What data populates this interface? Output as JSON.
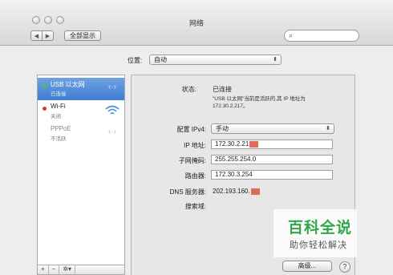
{
  "window": {
    "title": "网络"
  },
  "toolbar": {
    "back_icon": "chevron-left-icon",
    "forward_icon": "chevron-right-icon",
    "show_all": "全部显示",
    "search_placeholder": "",
    "search_icon": "magnifier-icon"
  },
  "location": {
    "label": "位置:",
    "value": "自动"
  },
  "services": [
    {
      "name": "USB 以太网",
      "status": "已连接",
      "dot_color": "#4cc24c",
      "icon": "ethernet-arrows-icon",
      "selected": true
    },
    {
      "name": "Wi-Fi",
      "status": "关闭",
      "dot_color": "#d93a31",
      "icon": "wifi-icon",
      "selected": false
    },
    {
      "name": "PPPoE",
      "status": "不活跃",
      "dot_color": "",
      "icon": "ethernet-arrows-icon",
      "selected": false
    }
  ],
  "sidebar_tools": {
    "add": "+",
    "remove": "−",
    "gear": "✲▾"
  },
  "detail": {
    "status_label": "状态:",
    "status_value": "已连接",
    "status_desc": "\"USB 以太网\"当前是活跃的,其 IP 地址为 172.30.2.217。",
    "config_label": "配置 IPv4:",
    "config_value": "手动",
    "ip_label": "IP 地址:",
    "ip_value": "172.30.2.21",
    "subnet_label": "子网掩码:",
    "subnet_value": "255.255.254.0",
    "router_label": "路由器:",
    "router_value": "172.30.3.254",
    "dns_label": "DNS 服务器:",
    "dns_value": "202.193.160.",
    "search_domain_label": "搜索域:",
    "advanced_button": "高级...",
    "help_button": "?"
  },
  "colors": {
    "selection": "#3f7cd2",
    "redaction": "#e26a5b",
    "watermark": "#2ea84a"
  },
  "watermark": {
    "line1": "百科全说",
    "line2": "助你轻松解决"
  }
}
